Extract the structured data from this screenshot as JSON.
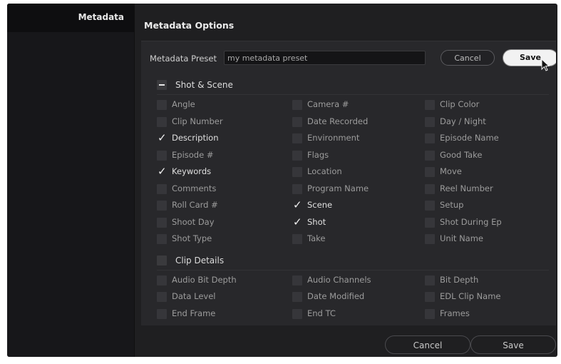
{
  "sidebar": {
    "items": [
      {
        "label": "Metadata",
        "selected": true
      }
    ]
  },
  "main": {
    "title": "Metadata Options"
  },
  "preset": {
    "label": "Metadata Preset",
    "value": "my metadata preset",
    "cancel_label": "Cancel",
    "save_label": "Save"
  },
  "sections": [
    {
      "title": "Shot & Scene",
      "state": "mixed",
      "items": [
        {
          "label": "Angle",
          "checked": false
        },
        {
          "label": "Camera #",
          "checked": false
        },
        {
          "label": "Clip Color",
          "checked": false
        },
        {
          "label": "Clip Number",
          "checked": false
        },
        {
          "label": "Date Recorded",
          "checked": false
        },
        {
          "label": "Day / Night",
          "checked": false
        },
        {
          "label": "Description",
          "checked": true
        },
        {
          "label": "Environment",
          "checked": false
        },
        {
          "label": "Episode Name",
          "checked": false
        },
        {
          "label": "Episode #",
          "checked": false
        },
        {
          "label": "Flags",
          "checked": false
        },
        {
          "label": "Good Take",
          "checked": false
        },
        {
          "label": "Keywords",
          "checked": true
        },
        {
          "label": "Location",
          "checked": false
        },
        {
          "label": "Move",
          "checked": false
        },
        {
          "label": "Comments",
          "checked": false
        },
        {
          "label": "Program Name",
          "checked": false
        },
        {
          "label": "Reel Number",
          "checked": false
        },
        {
          "label": "Roll Card #",
          "checked": false
        },
        {
          "label": "Scene",
          "checked": true
        },
        {
          "label": "Setup",
          "checked": false
        },
        {
          "label": "Shoot Day",
          "checked": false
        },
        {
          "label": "Shot",
          "checked": true
        },
        {
          "label": "Shot During Ep",
          "checked": false
        },
        {
          "label": "Shot Type",
          "checked": false
        },
        {
          "label": "Take",
          "checked": false
        },
        {
          "label": "Unit Name",
          "checked": false
        }
      ]
    },
    {
      "title": "Clip Details",
      "state": "unchecked",
      "items": [
        {
          "label": "Audio Bit Depth",
          "checked": false
        },
        {
          "label": "Audio Channels",
          "checked": false
        },
        {
          "label": "Bit Depth",
          "checked": false
        },
        {
          "label": "Data Level",
          "checked": false
        },
        {
          "label": "Date Modified",
          "checked": false
        },
        {
          "label": "EDL Clip Name",
          "checked": false
        },
        {
          "label": "End Frame",
          "checked": false
        },
        {
          "label": "End TC",
          "checked": false
        },
        {
          "label": "Frames",
          "checked": false
        }
      ]
    }
  ],
  "footer": {
    "cancel_label": "Cancel",
    "save_label": "Save"
  },
  "colors": {
    "window_bg": "#1f1f21",
    "panel_bg": "#28282b",
    "save_button_bg": "#f2f2f2"
  }
}
